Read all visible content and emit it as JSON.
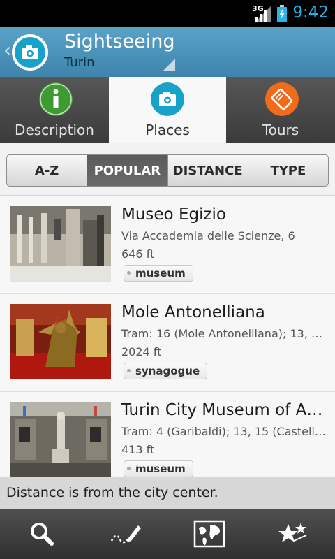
{
  "status_bar": {
    "network": "3G",
    "time": "9:42"
  },
  "header": {
    "back_icon": "chevron-left-icon",
    "app_icon": "camera-icon",
    "title": "Sightseeing",
    "subtitle": "Turin"
  },
  "tabs": [
    {
      "label": "Description",
      "icon": "info-icon",
      "color": "#3f9a34"
    },
    {
      "label": "Places",
      "icon": "camera-icon",
      "color": "#16a2c9",
      "active": true
    },
    {
      "label": "Tours",
      "icon": "ticket-icon",
      "color": "#f06b1c"
    }
  ],
  "sort": {
    "options": [
      "A-Z",
      "POPULAR",
      "DISTANCE",
      "TYPE"
    ],
    "selected": "POPULAR"
  },
  "places": [
    {
      "name": "Museo Egizio",
      "address": "Via Accademia delle Scienze, 6",
      "distance": "646 ft",
      "tag": "museum"
    },
    {
      "name": "Mole Antonelliana",
      "address": "Tram: 16 (Mole Antonelliana); 13, 1…",
      "distance": "2024 ft",
      "tag": "synagogue"
    },
    {
      "name": "Turin City Museum of An…",
      "address": "Tram: 4 (Garibaldi); 13, 15 (Castell…",
      "distance": "413 ft",
      "tag": "museum"
    }
  ],
  "info": {
    "text": "Distance is from the city center."
  },
  "bottom_nav": [
    "search-icon",
    "route-pencil-icon",
    "map-icon",
    "favorites-stars-icon"
  ],
  "colors": {
    "action_bar": "#4b93bb",
    "accent_blue": "#2ab4ec",
    "selected_segment": "#5f5f5f"
  }
}
